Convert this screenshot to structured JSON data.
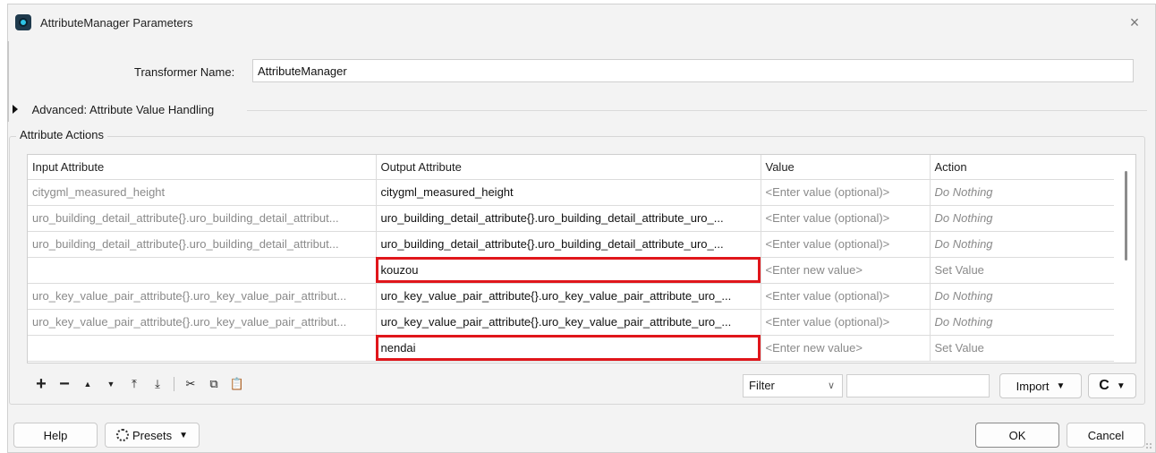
{
  "window": {
    "title": "AttributeManager Parameters",
    "close_glyph": "×"
  },
  "transformer": {
    "label": "Transformer Name:",
    "value": "AttributeManager"
  },
  "advanced": {
    "label": "Advanced: Attribute Value Handling"
  },
  "attribute_actions": {
    "title": "Attribute Actions",
    "columns": [
      "Input Attribute",
      "Output Attribute",
      "Value",
      "Action"
    ],
    "rows": [
      {
        "input": "citygml_measured_height",
        "output": "citygml_measured_height",
        "value": "<Enter value (optional)>",
        "action": "Do Nothing",
        "italic": true,
        "highlight": false
      },
      {
        "input": "uro_building_detail_attribute{}.uro_building_detail_attribut...",
        "output": "uro_building_detail_attribute{}.uro_building_detail_attribute_uro_...",
        "value": "<Enter value (optional)>",
        "action": "Do Nothing",
        "italic": true,
        "highlight": false
      },
      {
        "input": "uro_building_detail_attribute{}.uro_building_detail_attribut...",
        "output": "uro_building_detail_attribute{}.uro_building_detail_attribute_uro_...",
        "value": "<Enter value (optional)>",
        "action": "Do Nothing",
        "italic": true,
        "highlight": false
      },
      {
        "input": "",
        "output": "kouzou",
        "value": "<Enter new value>",
        "action": "Set Value",
        "italic": false,
        "highlight": true
      },
      {
        "input": "uro_key_value_pair_attribute{}.uro_key_value_pair_attribut...",
        "output": "uro_key_value_pair_attribute{}.uro_key_value_pair_attribute_uro_...",
        "value": "<Enter value (optional)>",
        "action": "Do Nothing",
        "italic": true,
        "highlight": false
      },
      {
        "input": "uro_key_value_pair_attribute{}.uro_key_value_pair_attribut...",
        "output": "uro_key_value_pair_attribute{}.uro_key_value_pair_attribute_uro_...",
        "value": "<Enter value (optional)>",
        "action": "Do Nothing",
        "italic": true,
        "highlight": false
      },
      {
        "input": "",
        "output": "nendai",
        "value": "<Enter new value>",
        "action": "Set Value",
        "italic": false,
        "highlight": true
      }
    ],
    "highlight_color": "#e0161b"
  },
  "toolbar": {
    "add": "+",
    "remove": "−",
    "move_up": "▲",
    "move_down": "▼",
    "move_top": "⤒",
    "move_bottom": "⤓",
    "cut": "✂",
    "copy": "⧉",
    "paste": "📋"
  },
  "filter": {
    "label": "Filter",
    "chevron": "∨",
    "text": ""
  },
  "buttons": {
    "import": "Import",
    "reload": "C",
    "help": "Help",
    "presets": "Presets",
    "ok": "OK",
    "cancel": "Cancel",
    "caret": "▼"
  }
}
